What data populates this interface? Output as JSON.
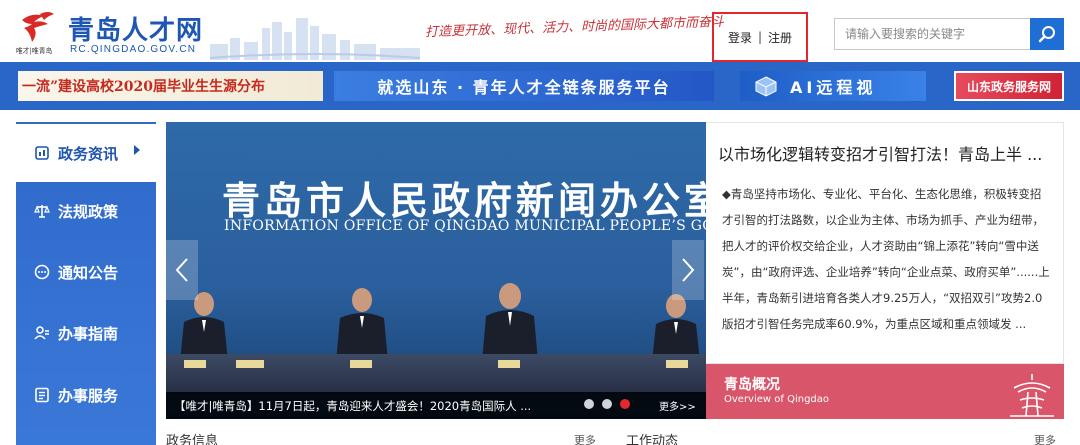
{
  "header": {
    "logo_title": "青岛人才网",
    "logo_sub": "RC.QINGDAO.GOV.CN",
    "logo_caption": "唯才|唯青岛",
    "slogan": "打造更开放、现代、活力、时尚的国际大都市而奋斗",
    "login_label": "登录",
    "auth_separator": "|",
    "register_label": "注册",
    "search_placeholder": "请输入要搜索的关键字"
  },
  "banners": {
    "b1": "一流”建设高校2020届毕业生生源分布",
    "b2": "就选山东 · 青年人才全链条服务平台",
    "b3": "AI远程视",
    "b4": "山东政务服务网"
  },
  "nav": {
    "items": [
      {
        "label": "政务资讯"
      },
      {
        "label": "法规政策"
      },
      {
        "label": "通知公告"
      },
      {
        "label": "办事指南"
      },
      {
        "label": "办事服务"
      }
    ]
  },
  "slider": {
    "title": "青岛市人民政府新闻办公室",
    "subtitle": "INFORMATION OFFICE OF QINGDAO MUNICIPAL PEOPLE’S GOVERNMENT",
    "caption": "【唯才|唯青岛】11月7日起，青岛迎来人才盛会！2020青岛国际人 ...",
    "more": "更多>>",
    "current_slide": 3,
    "slide_count": 3
  },
  "news": {
    "title": "以市场化逻辑转变招才引智打法！青岛上半 ...",
    "body": "◆青岛坚持市场化、专业化、平台化、生态化思维，积极转变招才引智的打法路数，以企业为主体、市场为抓手、产业为纽带，把人才的评价权交给企业，人才资助由“锦上添花”转向“雪中送炭”，由“政府评选、企业培养”转向“企业点菜、政府买单”......上半年，青岛新引进培育各类人才9.25万人，“双招双引”攻势2.0版招才引智任务完成率60.9%，为重点区域和重点领域发 ..."
  },
  "overview": {
    "title": "青岛概况",
    "subtitle": "Overview of Qingdao"
  },
  "bottom": {
    "left_title": "政务信息",
    "left_more": "更多",
    "right_title": "工作动态",
    "right_more": "更多"
  },
  "colors": {
    "primary_blue": "#2a66c8",
    "search_blue": "#1f6ed4",
    "highlight_red": "#e3272c",
    "overview_pink": "#d9556a"
  }
}
